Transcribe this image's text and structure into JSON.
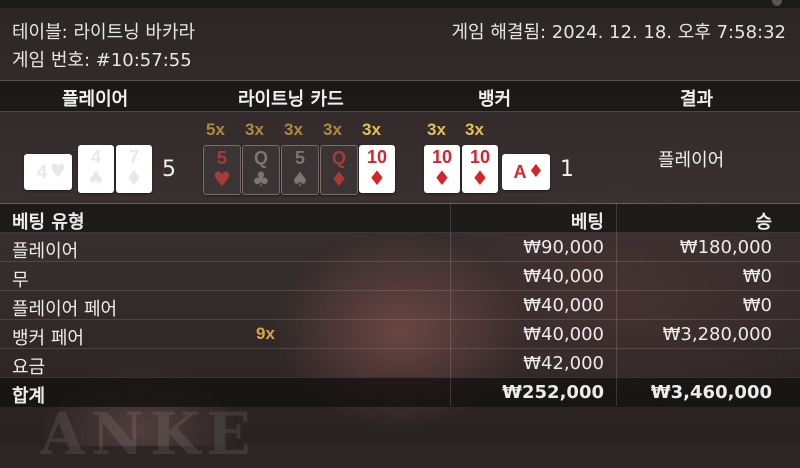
{
  "info": {
    "table": "테이블: 라이트닝 바카라",
    "game_id": "게임 번호: #10:57:55",
    "resolved": "게임 해결됨: 2024. 12. 18. 오후 7:58:32"
  },
  "watermark": "ANKE",
  "round": {
    "headers": {
      "player": "플레이어",
      "lightning": "라이트닝 카드",
      "banker": "뱅커",
      "result": "결과"
    },
    "player": {
      "cards": [
        {
          "rank": "4",
          "suit": "♥",
          "color": "red",
          "orientation": "side"
        },
        {
          "rank": "4",
          "suit": "♠",
          "color": "black",
          "orientation": "up"
        },
        {
          "rank": "7",
          "suit": "♦",
          "color": "red",
          "orientation": "up"
        }
      ],
      "score": "5"
    },
    "lightning": {
      "cards": [
        {
          "rank": "5",
          "suit": "♥",
          "color": "red",
          "multiplier": "5x",
          "active": false
        },
        {
          "rank": "Q",
          "suit": "♣",
          "color": "black",
          "multiplier": "3x",
          "active": false
        },
        {
          "rank": "5",
          "suit": "♠",
          "color": "black",
          "multiplier": "3x",
          "active": false
        },
        {
          "rank": "Q",
          "suit": "♦",
          "color": "red",
          "multiplier": "3x",
          "active": false
        },
        {
          "rank": "10",
          "suit": "♦",
          "color": "red",
          "multiplier": "3x",
          "active": true
        }
      ]
    },
    "banker": {
      "cards": [
        {
          "rank": "10",
          "suit": "♦",
          "color": "red",
          "multiplier": "3x",
          "orientation": "up"
        },
        {
          "rank": "10",
          "suit": "♦",
          "color": "red",
          "multiplier": "3x",
          "orientation": "up"
        },
        {
          "rank": "A",
          "suit": "♦",
          "color": "red",
          "orientation": "side"
        }
      ],
      "score": "1"
    },
    "result": "플레이어"
  },
  "bets": {
    "headers": {
      "type": "베팅 유형",
      "bet": "베팅",
      "win": "승"
    },
    "rows": [
      {
        "type": "플레이어",
        "bet": "₩90,000",
        "win": "₩180,000",
        "multiplier": ""
      },
      {
        "type": "무",
        "bet": "₩40,000",
        "win": "₩0",
        "multiplier": ""
      },
      {
        "type": "플레이어 페어",
        "bet": "₩40,000",
        "win": "₩0",
        "multiplier": ""
      },
      {
        "type": "뱅커 페어",
        "bet": "₩40,000",
        "win": "₩3,280,000",
        "multiplier": "9x"
      },
      {
        "type": "요금",
        "bet": "₩42,000",
        "win": "",
        "multiplier": ""
      }
    ],
    "total": {
      "type": "합계",
      "bet": "₩252,000",
      "win": "₩3,460,000"
    }
  }
}
